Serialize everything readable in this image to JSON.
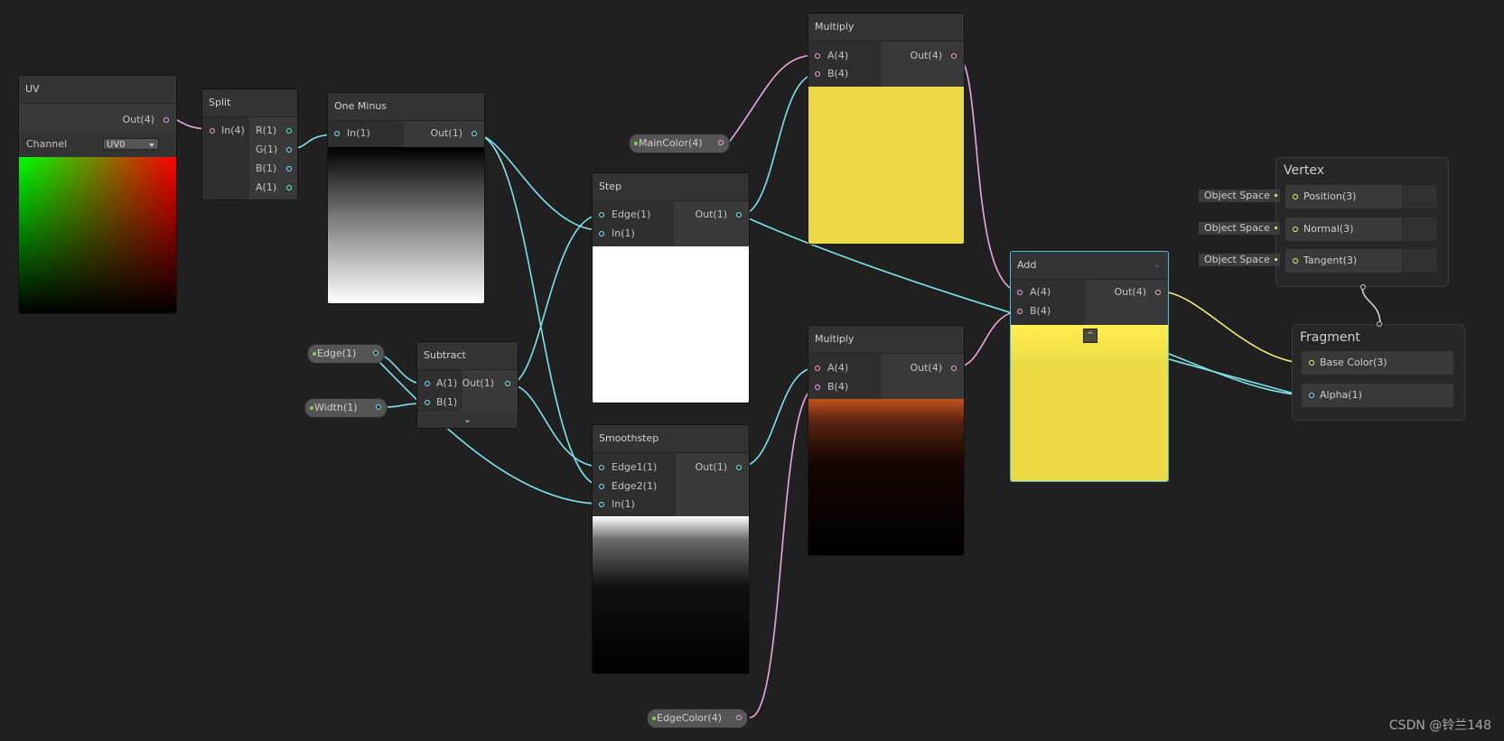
{
  "nodes": {
    "uv": {
      "title": "UV",
      "out": "Out(4)",
      "channel_label": "Channel",
      "channel_value": "UV0"
    },
    "split": {
      "title": "Split",
      "in": "In(4)",
      "outs": [
        "R(1)",
        "G(1)",
        "B(1)",
        "A(1)"
      ]
    },
    "one_minus": {
      "title": "One Minus",
      "in": "In(1)",
      "out": "Out(1)"
    },
    "step": {
      "title": "Step",
      "ins": [
        "Edge(1)",
        "In(1)"
      ],
      "out": "Out(1)"
    },
    "subtract": {
      "title": "Subtract",
      "ins": [
        "A(1)",
        "B(1)"
      ],
      "out": "Out(1)"
    },
    "smoothstep": {
      "title": "Smoothstep",
      "ins": [
        "Edge1(1)",
        "Edge2(1)",
        "In(1)"
      ],
      "out": "Out(1)"
    },
    "multiply_top": {
      "title": "Multiply",
      "ins": [
        "A(4)",
        "B(4)"
      ],
      "out": "Out(4)"
    },
    "multiply_bottom": {
      "title": "Multiply",
      "ins": [
        "A(4)",
        "B(4)"
      ],
      "out": "Out(4)"
    },
    "add": {
      "title": "Add",
      "ins": [
        "A(4)",
        "B(4)"
      ],
      "out": "Out(4)"
    }
  },
  "properties": {
    "main_color": "MainColor(4)",
    "edge": "Edge(1)",
    "width": "Width(1)",
    "edge_color": "EdgeColor(4)"
  },
  "vertex": {
    "title": "Vertex",
    "inputs": [
      "Position(3)",
      "Normal(3)",
      "Tangent(3)"
    ],
    "space_label": "Object Space"
  },
  "fragment": {
    "title": "Fragment",
    "inputs": [
      "Base Color(3)",
      "Alpha(1)"
    ]
  },
  "colors": {
    "background": "#202020",
    "vector1_wire": "#7fe3e8",
    "vector4_wire": "#e9a9d9",
    "vector3_wire": "#f1f17e",
    "main_color": "#ecdb46"
  },
  "watermark": "CSDN @铃兰148"
}
